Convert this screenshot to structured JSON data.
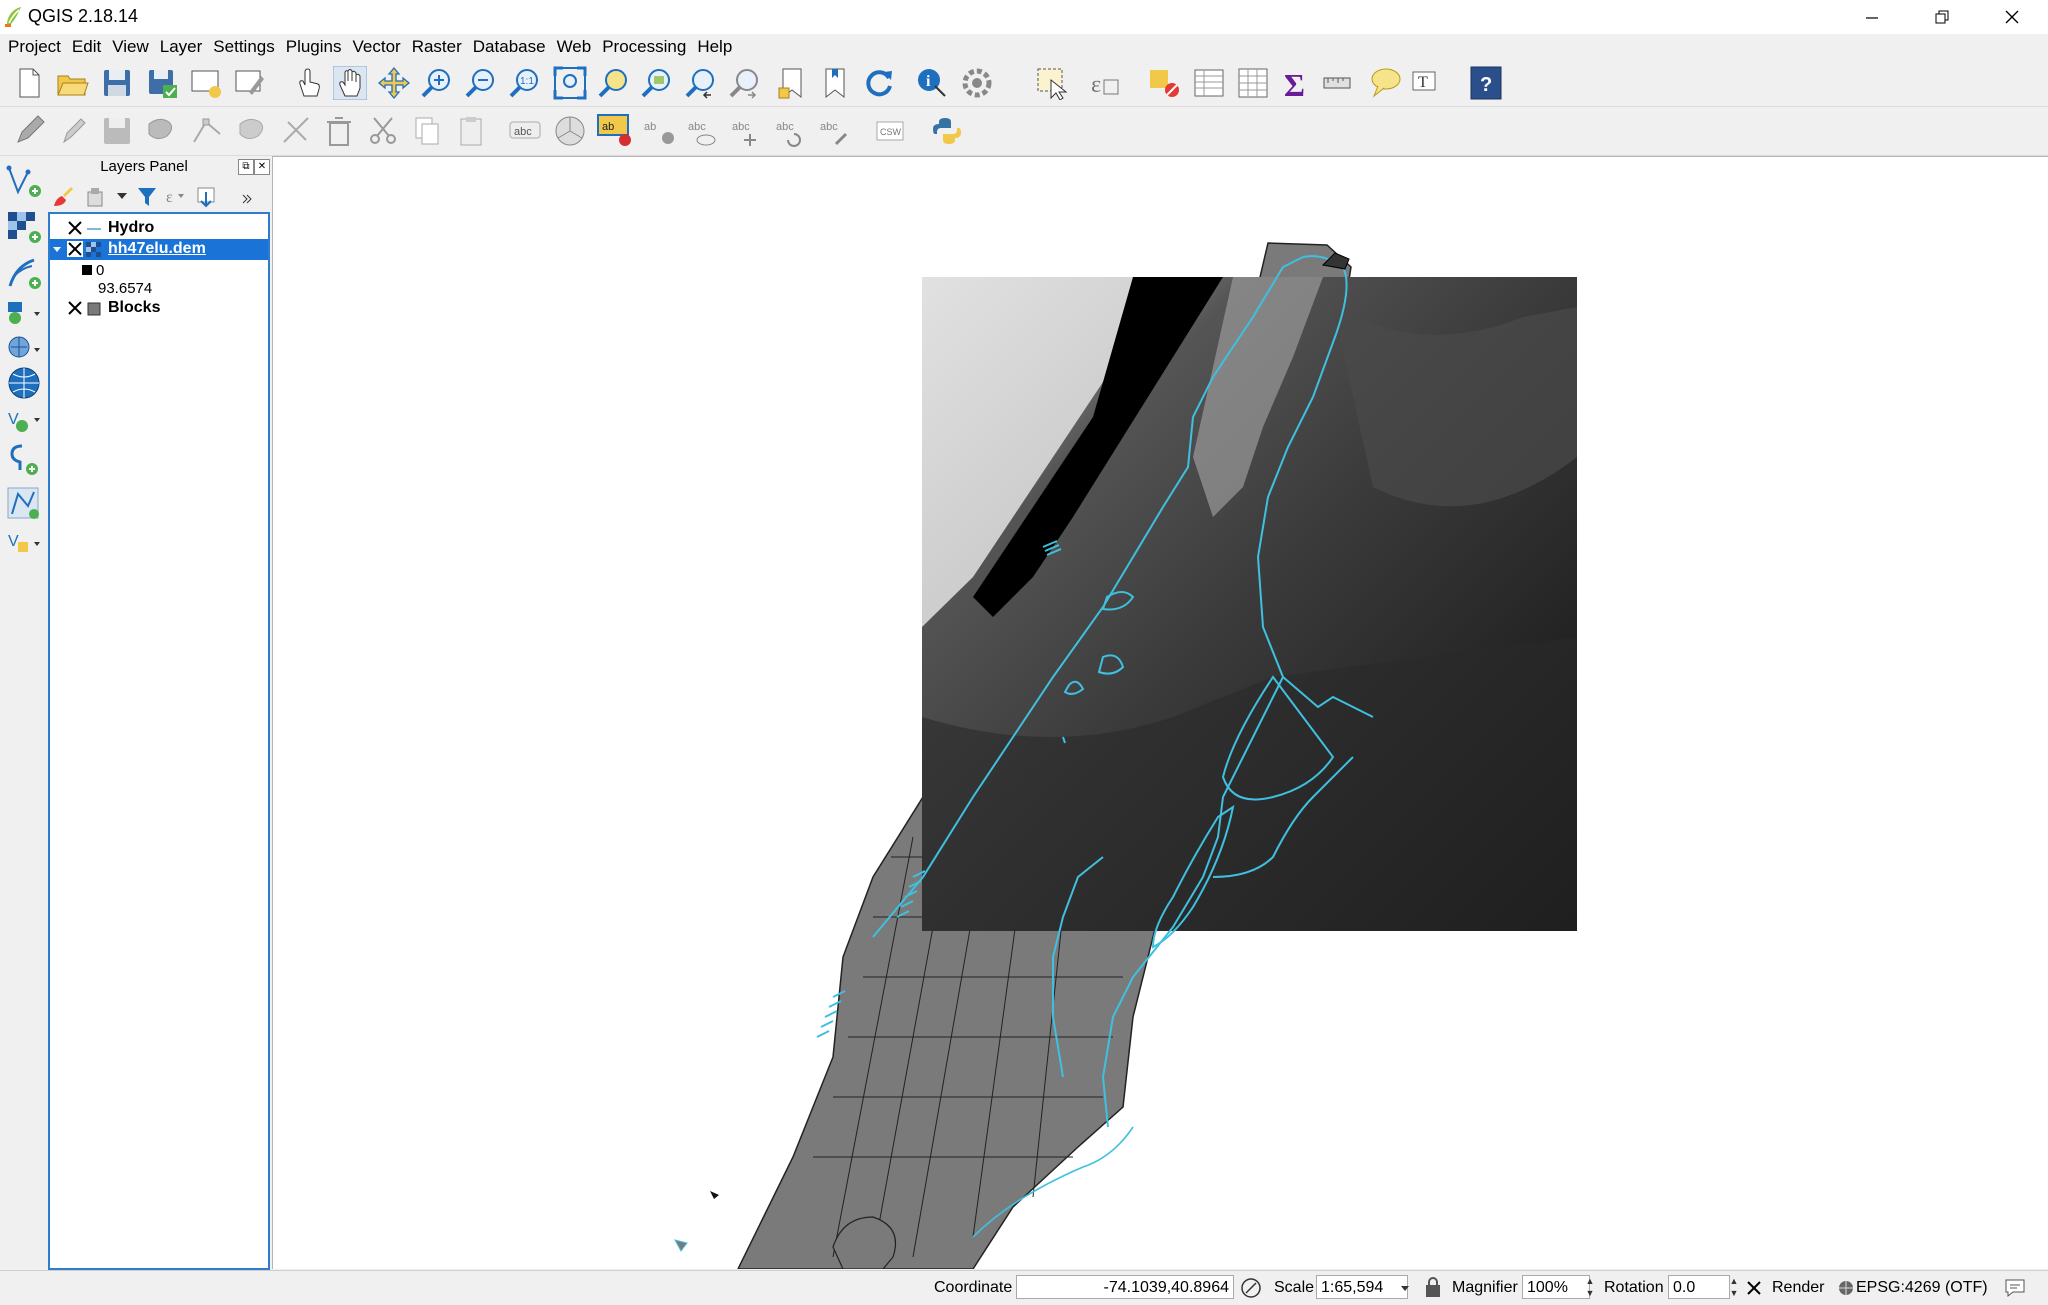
{
  "window": {
    "title": "QGIS 2.18.14",
    "controls": [
      "minimize",
      "restore",
      "close"
    ]
  },
  "menubar": {
    "items": [
      "Project",
      "Edit",
      "View",
      "Layer",
      "Settings",
      "Plugins",
      "Vector",
      "Raster",
      "Database",
      "Web",
      "Processing",
      "Help"
    ]
  },
  "layers_panel": {
    "title": "Layers Panel",
    "layers": [
      {
        "name": "Hydro",
        "visible": false,
        "type": "line",
        "color": "#7fb8d8"
      },
      {
        "name": "hh47elu.dem",
        "visible": false,
        "type": "raster",
        "selected": true
      },
      {
        "name": "Blocks",
        "visible": false,
        "type": "polygon",
        "color": "#7a7a7a"
      }
    ],
    "raster_legend": {
      "min": "0",
      "max": "93.6574"
    }
  },
  "statusbar": {
    "coordinate_label": "Coordinate",
    "coordinate_value": "-74.1039,40.8964",
    "scale_label": "Scale",
    "scale_value": "1:65,594",
    "magnifier_label": "Magnifier",
    "magnifier_value": "100%",
    "rotation_label": "Rotation",
    "rotation_value": "0.0",
    "render_label": "Render",
    "crs": "EPSG:4269 (OTF)"
  },
  "colors": {
    "accent": "#1a73d6",
    "hydro": "#3fc0e0",
    "blocks": "#767676",
    "toolbar_bg": "#f0f0f0"
  },
  "icons": {
    "toolbar1": [
      "new-project-icon",
      "open-project-icon",
      "save-project-icon",
      "save-as-icon",
      "new-print-composer-icon",
      "composer-manager-icon",
      "touch-icon",
      "pan-icon",
      "pan-to-selection-icon",
      "zoom-in-icon",
      "zoom-out-icon",
      "zoom-actual-size-icon",
      "zoom-full-icon",
      "zoom-to-selection-icon",
      "zoom-to-layer-icon",
      "zoom-last-icon",
      "zoom-next-icon",
      "new-bookmark-icon",
      "show-bookmarks-icon",
      "refresh-icon",
      "identify-icon",
      "run-feature-action-icon",
      "select-features-icon",
      "select-by-value-icon",
      "deselect-all-icon",
      "open-attribute-table-icon",
      "field-calculator-icon",
      "statistics-icon",
      "measure-icon",
      "map-tips-icon",
      "text-annotation-icon",
      "help-icon"
    ],
    "toolbar2": [
      "toggle-editing-icon",
      "current-edits-icon",
      "save-edits-icon",
      "add-feature-icon",
      "node-tool-icon",
      "move-feature-icon",
      "delete-selected-icon",
      "cut-features-icon",
      "copy-features-icon",
      "paste-features-icon",
      "label-icon",
      "diagram-icon",
      "highlight-pinned-labels-icon",
      "pin-labels-icon",
      "show-hide-labels-icon",
      "move-label-icon",
      "rotate-label-icon",
      "change-label-icon",
      "csw-icon",
      "python-icon"
    ],
    "vtoolbar": [
      "add-vector-layer-icon",
      "add-raster-layer-icon",
      "add-delimited-text-icon",
      "add-spatialite-icon",
      "add-wms-icon",
      "add-wfs-icon",
      "add-virtual-layer-icon",
      "new-shapefile-icon",
      "new-temporary-layer-icon"
    ]
  }
}
